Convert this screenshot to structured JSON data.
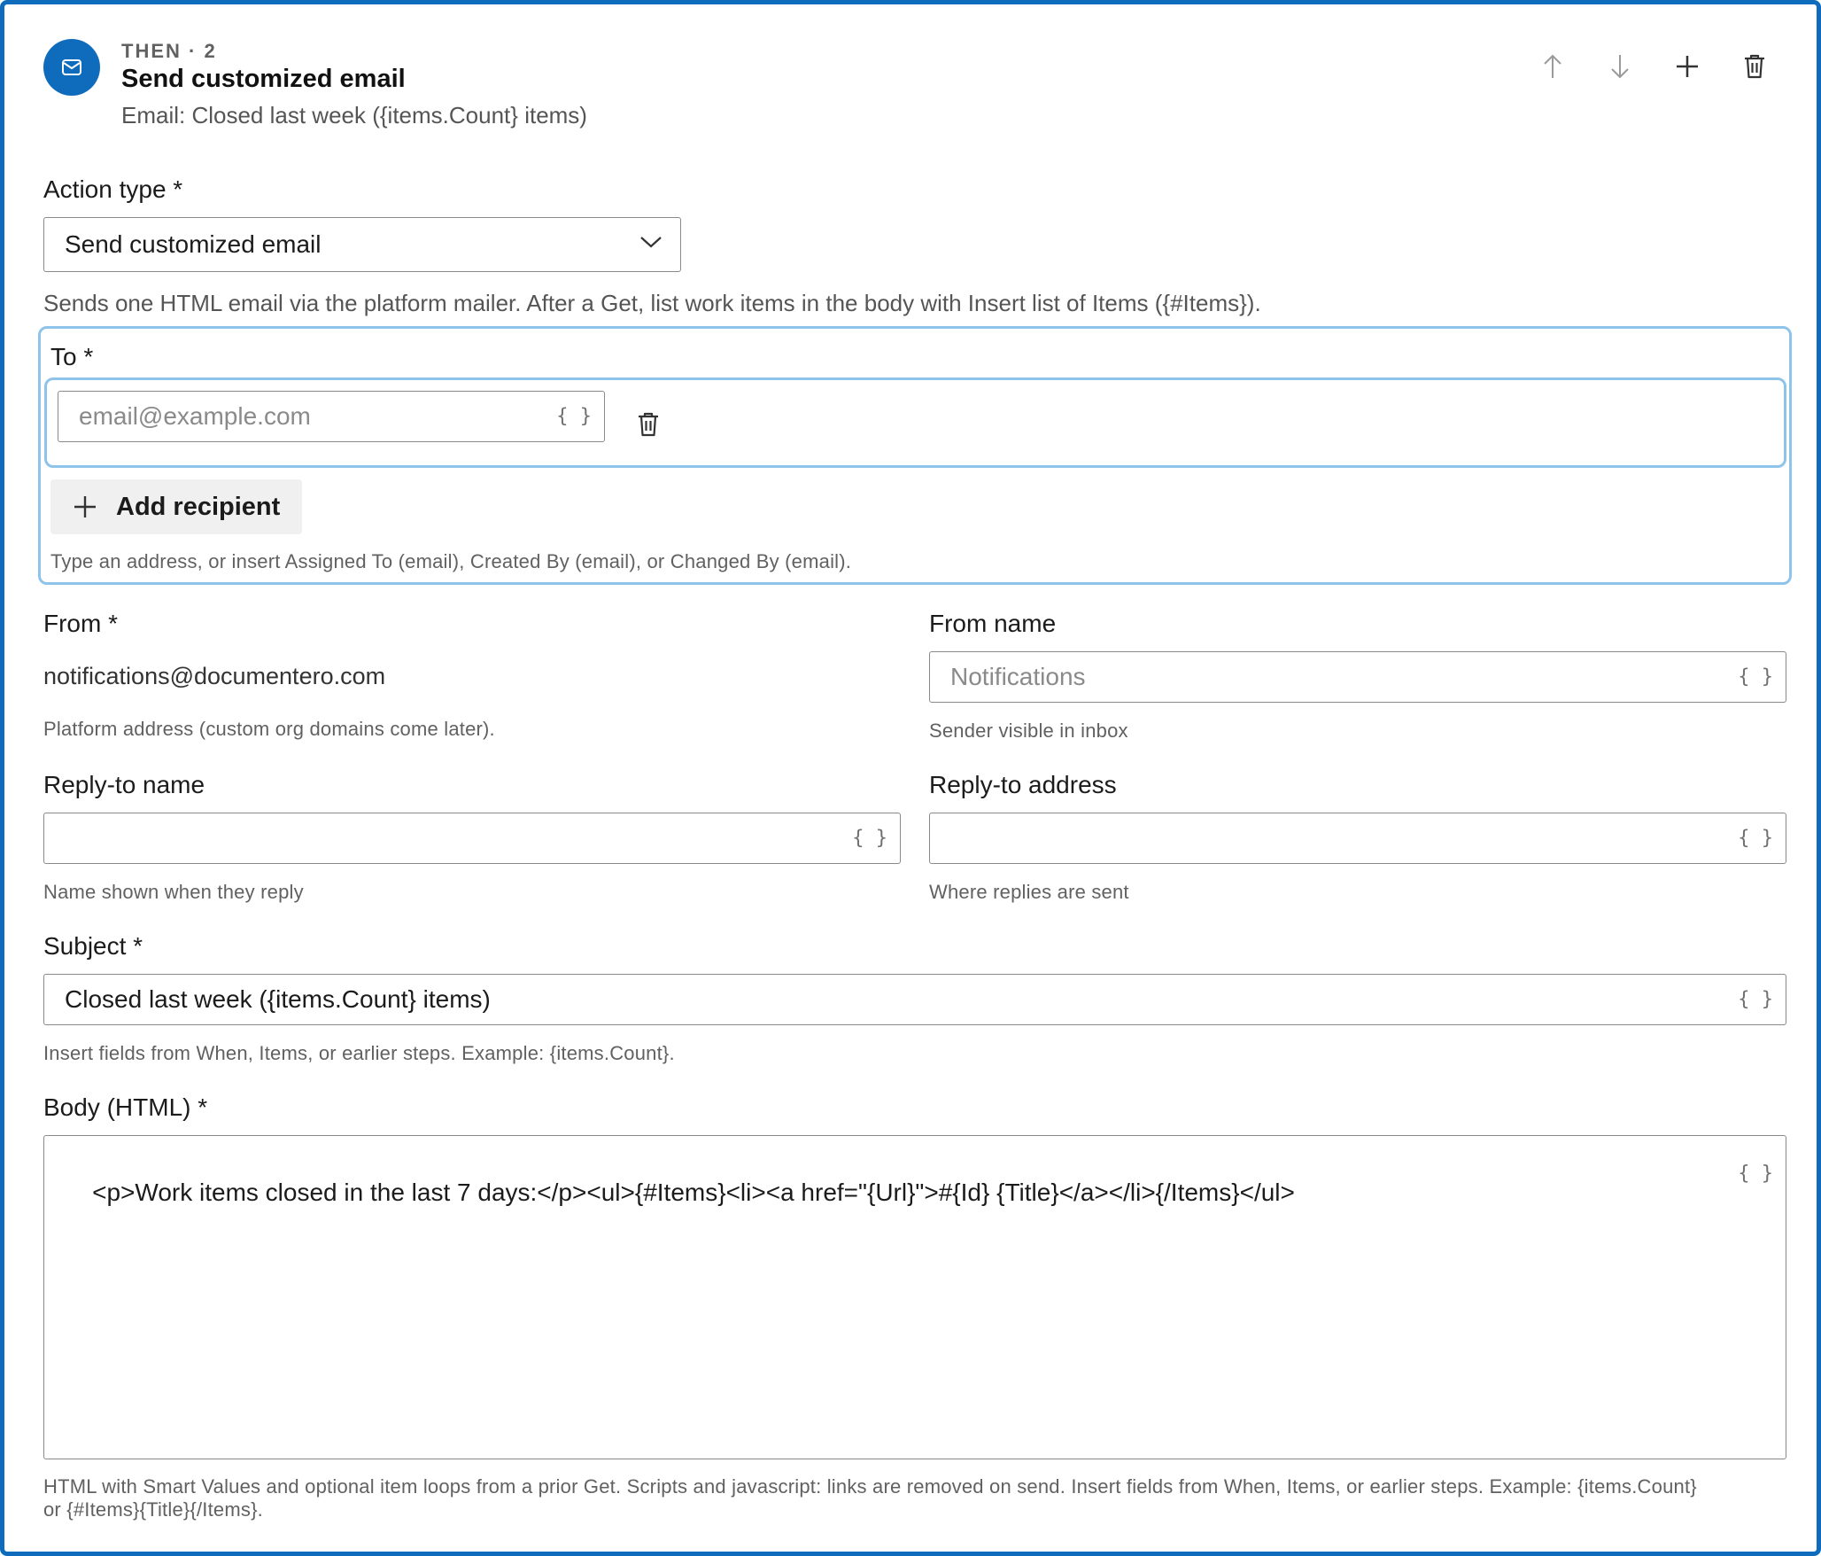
{
  "header": {
    "eyebrow": "THEN · 2",
    "title": "Send customized email",
    "subtitle": "Email: Closed last week ({items.Count} items)",
    "icons": [
      "mail-icon",
      "arrow-up-icon",
      "arrow-down-icon",
      "plus-icon",
      "trash-icon"
    ]
  },
  "action_type": {
    "label": "Action type *",
    "value": "Send customized email",
    "description": "Sends one HTML email via the platform mailer. After a Get, list work items in the body with Insert list of Items ({#Items})."
  },
  "to": {
    "label": "To *",
    "placeholder": "email@example.com",
    "braces": "{ }",
    "add_label": "Add recipient",
    "help": "Type an address, or insert Assigned To (email), Created By (email), or Changed By (email)."
  },
  "from": {
    "label": "From *",
    "value": "notifications@documentero.com",
    "help": "Platform address (custom org domains come later)."
  },
  "from_name": {
    "label": "From name",
    "placeholder": "Notifications",
    "help": "Sender visible in inbox"
  },
  "reply_to_name": {
    "label": "Reply-to name",
    "value": "",
    "help": "Name shown when they reply"
  },
  "reply_to_address": {
    "label": "Reply-to address",
    "value": "",
    "help": "Where replies are sent"
  },
  "subject": {
    "label": "Subject *",
    "value": "Closed last week ({items.Count} items)",
    "help": "Insert fields from When, Items, or earlier steps. Example: {items.Count}."
  },
  "body": {
    "label": "Body (HTML) *",
    "value": "<p>Work items closed in the last 7 days:</p><ul>{#Items}<li><a href=\"{Url}\">#{Id} {Title}</a></li>{/Items}</ul>",
    "help_line1": "HTML with Smart Values and optional item loops from a prior Get. Scripts and javascript: links are removed on send. Insert fields from When, Items, or earlier steps. Example: {items.Count}",
    "help_line2": "or {#Items}{Title}{/Items}."
  },
  "colors": {
    "accent": "#0f6cbd",
    "focus_border": "#8ec3ea",
    "secondary_button": "#f0f0f0"
  }
}
